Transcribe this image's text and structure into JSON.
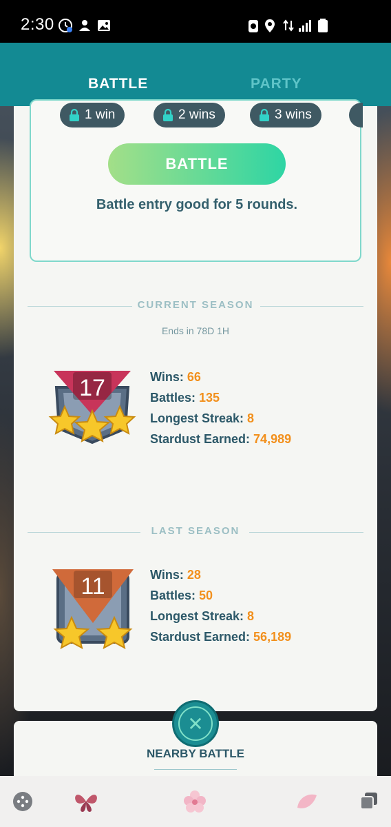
{
  "status_bar": {
    "time": "2:30",
    "icons": [
      "clock-badge-icon",
      "app-icon",
      "gallery-icon",
      "battery-saver-icon",
      "location-icon",
      "data-arrows-icon",
      "signal-icon",
      "battery-icon"
    ]
  },
  "tabs": [
    {
      "label": "BATTLE",
      "active": true
    },
    {
      "label": "PARTY",
      "active": false
    }
  ],
  "rewards": [
    {
      "label": "1 win"
    },
    {
      "label": "2 wins"
    },
    {
      "label": "3 wins"
    }
  ],
  "battle_button": "BATTLE",
  "entry_note": "Battle entry good for 5 rounds.",
  "current_season": {
    "heading": "CURRENT SEASON",
    "ends": "Ends in 78D 1H",
    "rank": "17",
    "stars": 3,
    "badge_color": "#c8345a",
    "stats": [
      {
        "label": "Wins:",
        "value": "66"
      },
      {
        "label": "Battles:",
        "value": "135"
      },
      {
        "label": "Longest Streak:",
        "value": "8"
      },
      {
        "label": "Stardust Earned:",
        "value": "74,989"
      }
    ]
  },
  "last_season": {
    "heading": "LAST SEASON",
    "rank": "11",
    "stars": 2,
    "badge_color": "#d06a3a",
    "stats": [
      {
        "label": "Wins:",
        "value": "28"
      },
      {
        "label": "Battles:",
        "value": "50"
      },
      {
        "label": "Longest Streak:",
        "value": "8"
      },
      {
        "label": "Stardust Earned:",
        "value": "56,189"
      }
    ]
  },
  "nearby_label": "NEARBY BATTLE",
  "bottom_nav": [
    "game-controller-icon",
    "butterfly-icon",
    "blossom-icon",
    "petal-icon",
    "recent-apps-icon"
  ],
  "colors": {
    "header": "#138a93",
    "accent_value": "#f2901d",
    "stat_label": "#2c5868"
  }
}
